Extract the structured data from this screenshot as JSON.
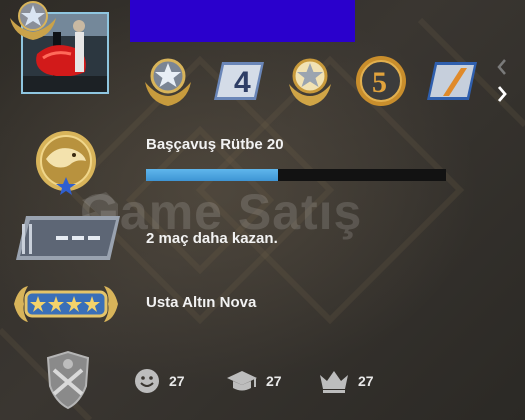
{
  "profile": {
    "name_bar_color": "#2a00cc",
    "avatar_frame_color": "#8fc6e0"
  },
  "medals": [
    {
      "name": "star-medal-icon"
    },
    {
      "name": "4-year-veteran-coin-icon"
    },
    {
      "name": "silver-star-medal-icon"
    },
    {
      "name": "5-year-veteran-coin-icon"
    },
    {
      "name": "7-year-veteran-coin-icon"
    }
  ],
  "competitive": {
    "rank_label": "Başçavuş Rütbe 20",
    "progress": 0.44
  },
  "wingman": {
    "label": "2 maç daha kazan."
  },
  "skill": {
    "label": "Usta Altın Nova"
  },
  "watermark": {
    "text": "Game Satış"
  },
  "commendations": {
    "friendly": "27",
    "teacher": "27",
    "leader": "27"
  },
  "colors": {
    "progress_fill": "#4fa8e2",
    "gold": "#d8b45a",
    "accent_blue": "#3b7fd6"
  }
}
